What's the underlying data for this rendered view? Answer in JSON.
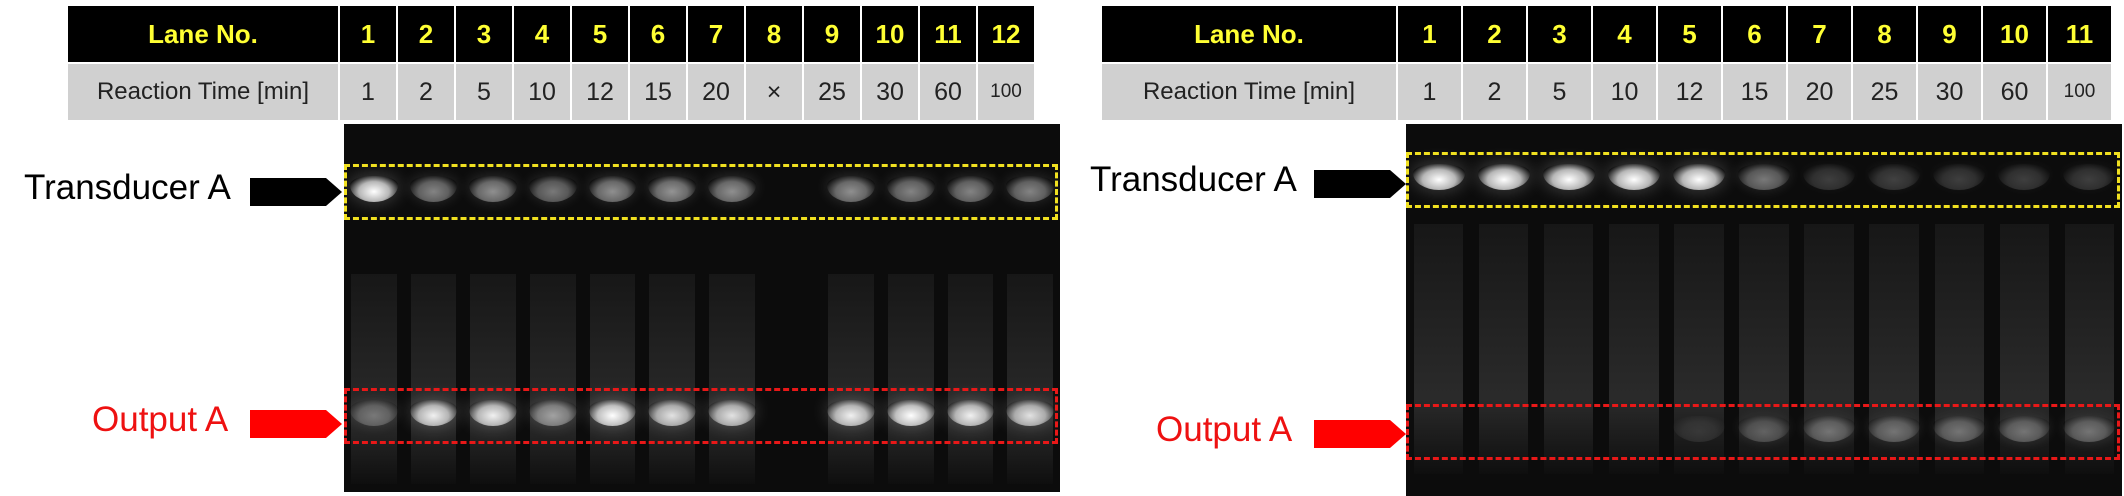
{
  "left_panel": {
    "lane_header": "Lane No.",
    "time_header": "Reaction Time [min]",
    "lanes": [
      "1",
      "2",
      "3",
      "4",
      "5",
      "6",
      "7",
      "8",
      "9",
      "10",
      "11",
      "12"
    ],
    "times": [
      "1",
      "2",
      "5",
      "10",
      "12",
      "15",
      "20",
      "×",
      "25",
      "30",
      "60",
      "100"
    ],
    "transducer_label": "Transducer A",
    "output_label": "Output A",
    "transducer_intensity": [
      1.0,
      0.55,
      0.6,
      0.5,
      0.6,
      0.62,
      0.6,
      0,
      0.6,
      0.55,
      0.55,
      0.55
    ],
    "output_intensity": [
      0.45,
      0.95,
      0.95,
      0.65,
      1.0,
      0.9,
      0.9,
      0,
      0.95,
      1.0,
      0.95,
      0.9
    ]
  },
  "right_panel": {
    "lane_header": "Lane No.",
    "time_header": "Reaction Time [min]",
    "lanes": [
      "1",
      "2",
      "3",
      "4",
      "5",
      "6",
      "7",
      "8",
      "9",
      "10",
      "11"
    ],
    "times": [
      "1",
      "2",
      "5",
      "10",
      "12",
      "15",
      "20",
      "25",
      "30",
      "60",
      "100"
    ],
    "transducer_label": "Transducer A",
    "output_label": "Output A",
    "transducer_intensity": [
      1.0,
      1.0,
      1.0,
      1.0,
      1.0,
      0.5,
      0.18,
      0.2,
      0.18,
      0.18,
      0.18
    ],
    "output_intensity": [
      0,
      0,
      0,
      0,
      0.05,
      0.35,
      0.45,
      0.45,
      0.45,
      0.45,
      0.45
    ]
  },
  "colors": {
    "lane_row_bg": "#000000",
    "lane_row_text": "#ffff33",
    "time_row_bg": "#d0d0d0",
    "transducer_box": "#f0e020",
    "output_box": "#e81818",
    "output_label": "#ee1111"
  }
}
